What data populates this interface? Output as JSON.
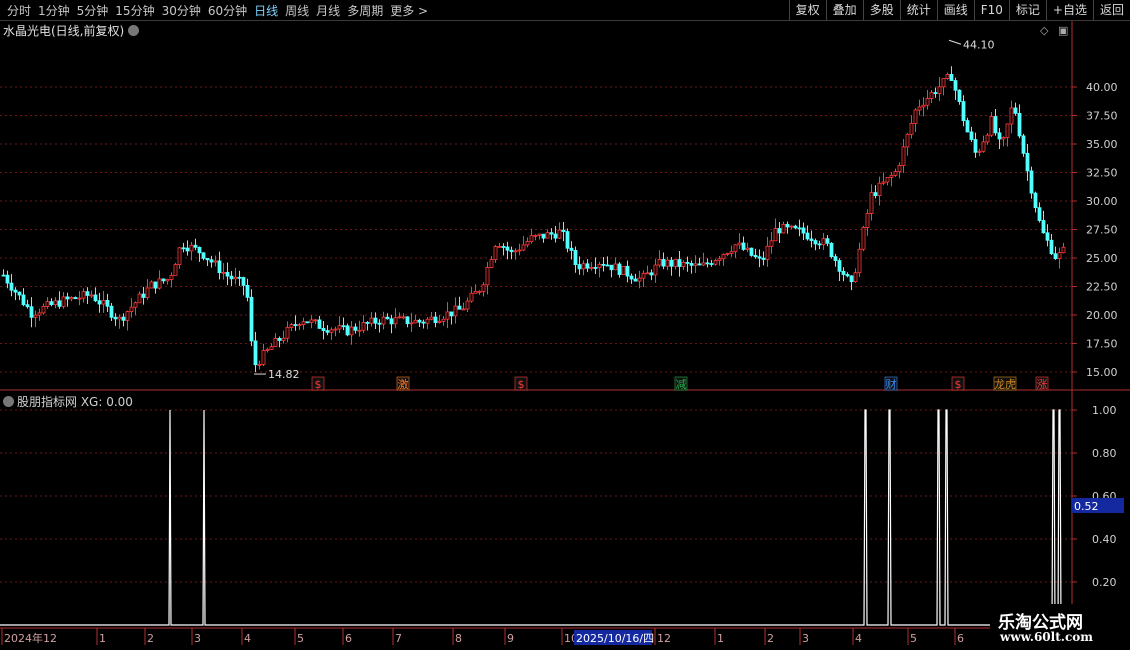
{
  "toolbar": {
    "periods": [
      "分时",
      "1分钟",
      "5分钟",
      "15分钟",
      "30分钟",
      "60分钟",
      "日线",
      "周线",
      "月线",
      "多周期",
      "更多 >"
    ],
    "active_period": "日线",
    "actions": [
      "复权",
      "叠加",
      "多股",
      "统计",
      "画线",
      "F10",
      "标记",
      "+自选",
      "返回"
    ]
  },
  "chart": {
    "title": "水晶光电(日线,前复权)",
    "high_marker": "44.10",
    "low_marker": "14.82",
    "price_ticks": [
      "40.00",
      "37.50",
      "35.00",
      "32.50",
      "30.00",
      "27.50",
      "25.00",
      "22.50",
      "20.00",
      "17.50",
      "15.00"
    ],
    "event_badges": [
      {
        "label": "$",
        "color": "#ff3b3b"
      },
      {
        "label": "激",
        "color": "#ff7a2a"
      },
      {
        "label": "$",
        "color": "#ff3b3b"
      },
      {
        "label": "减",
        "color": "#22b04a"
      },
      {
        "label": "财",
        "color": "#3a8fff"
      },
      {
        "label": "$",
        "color": "#ff3b3b"
      },
      {
        "label": "龙虎",
        "color": "#d08a20"
      },
      {
        "label": "涨",
        "color": "#ff3b3b"
      }
    ],
    "up_color": "#ff3b3b",
    "down_color": "#54ffff"
  },
  "indicator": {
    "title": "股朋指标网 XG: 0.00",
    "ticks": [
      "1.00",
      "0.80",
      "0.60",
      "0.40",
      "0.20"
    ],
    "current_value": "0.52",
    "signal_days": [
      169,
      171,
      203,
      205,
      864,
      867,
      888,
      891,
      937,
      940,
      945,
      948,
      1052,
      1055,
      1058,
      1061
    ]
  },
  "timeline": {
    "labels": [
      "2024年12",
      "1",
      "2",
      "3",
      "4",
      "5",
      "6",
      "7",
      "8",
      "9",
      "10",
      "12",
      "1",
      "2",
      "3",
      "4",
      "5",
      "6"
    ],
    "cursor_date": "2025/10/16/四"
  },
  "watermark": {
    "main": "乐淘公式网",
    "url": "www.60lt.com"
  }
}
